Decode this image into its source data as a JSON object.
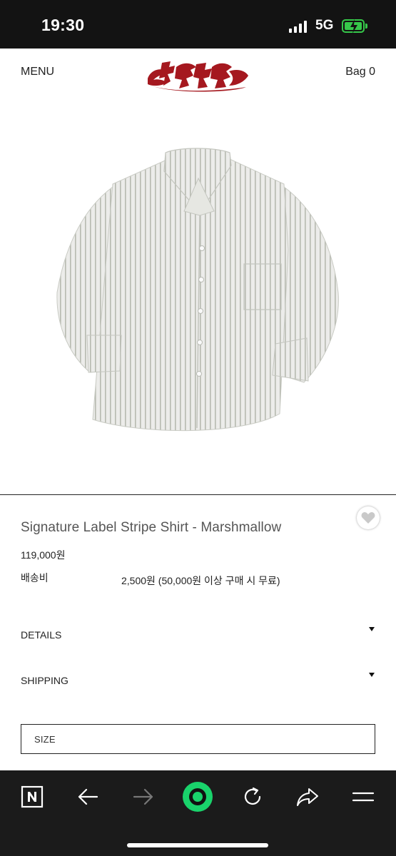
{
  "status_bar": {
    "time": "19:30",
    "network": "5G",
    "battery_color": "#36c84a"
  },
  "header": {
    "menu_label": "MENU",
    "bag_label": "Bag 0",
    "logo_color": "#a5181f"
  },
  "product": {
    "image_icon": "striped-shirt-photo",
    "name": "Signature Label Stripe Shirt - Marshmallow",
    "price": "119,000원",
    "shipping_label": "배송비",
    "shipping_value": "2,500원 (50,000원 이상 구매 시 무료)",
    "wishlist_icon": "heart-icon"
  },
  "accordions": {
    "details_label": "DETAILS",
    "shipping_label": "SHIPPING"
  },
  "size_select": {
    "placeholder": "SIZE"
  },
  "browser_bar": {
    "accent_color": "#19d36b",
    "icons": [
      "naver-n-icon",
      "back-arrow-icon",
      "forward-arrow-icon",
      "green-dot-icon",
      "reload-icon",
      "share-icon",
      "menu-icon"
    ]
  }
}
